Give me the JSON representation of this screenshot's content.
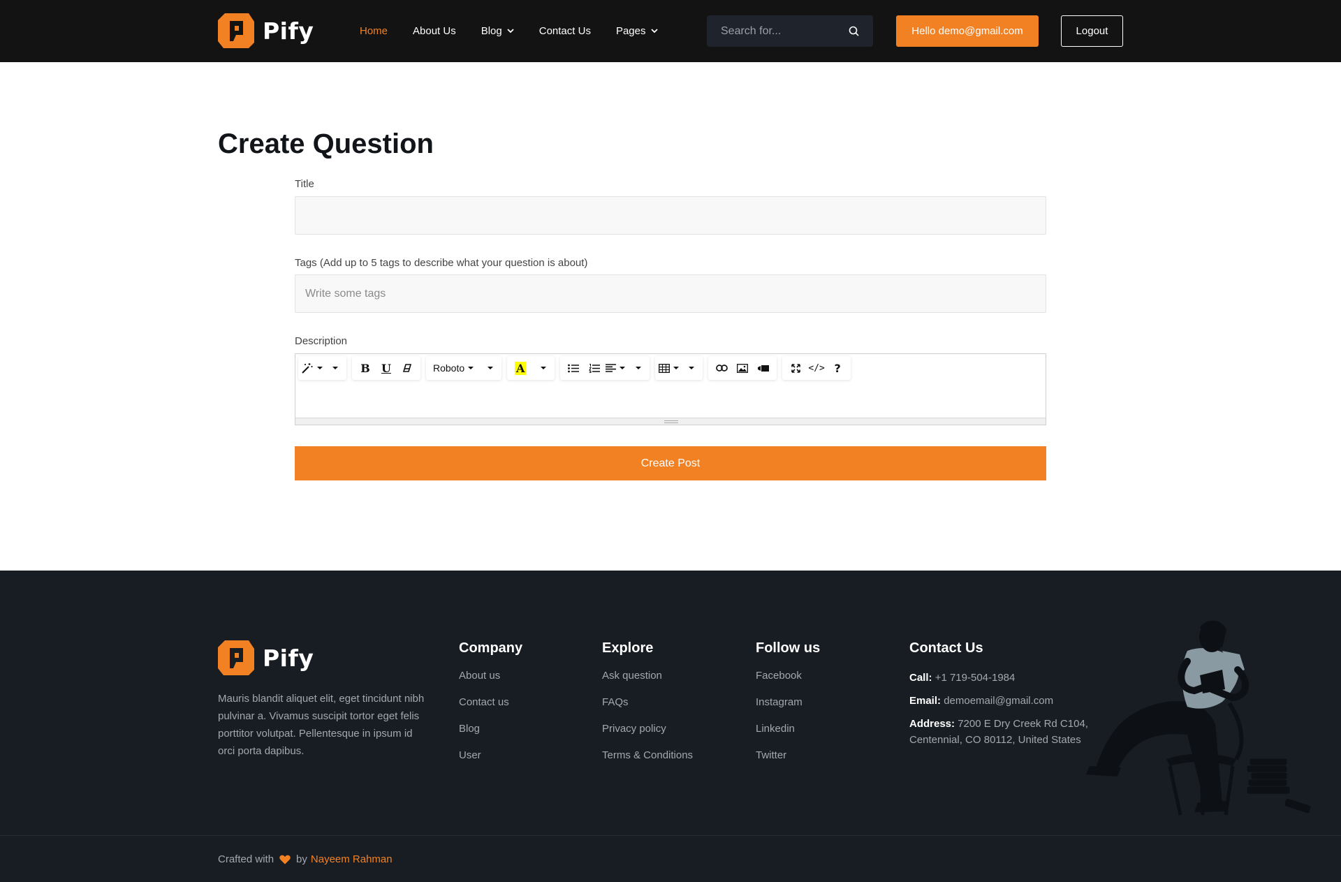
{
  "header": {
    "brand": "Pify",
    "nav": [
      {
        "label": "Home",
        "active": true
      },
      {
        "label": "About Us"
      },
      {
        "label": "Blog",
        "dropdown": true
      },
      {
        "label": "Contact Us"
      },
      {
        "label": "Pages",
        "dropdown": true
      }
    ],
    "search_placeholder": "Search for...",
    "hello_label": "Hello demo@gmail.com",
    "logout_label": "Logout"
  },
  "main": {
    "title": "Create Question",
    "title_label": "Title",
    "title_value": "",
    "tags_label": "Tags (Add up to 5 tags to describe what your question is about)",
    "tags_placeholder": "Write some tags",
    "description_label": "Description",
    "editor_font": "Roboto",
    "submit_label": "Create Post"
  },
  "footer": {
    "brand": "Pify",
    "about": "Mauris blandit aliquet elit, eget tincidunt nibh pulvinar a. Vivamus suscipit tortor eget felis porttitor volutpat. Pellentesque in ipsum id orci porta dapibus.",
    "company": {
      "title": "Company",
      "links": [
        "About us",
        "Contact us",
        "Blog",
        "User"
      ]
    },
    "explore": {
      "title": "Explore",
      "links": [
        "Ask question",
        "FAQs",
        "Privacy policy",
        "Terms & Conditions"
      ]
    },
    "follow": {
      "title": "Follow us",
      "links": [
        "Facebook",
        "Instagram",
        "Linkedin",
        "Twitter"
      ]
    },
    "contact": {
      "title": "Contact Us",
      "call_label": "Call:",
      "call_value": "+1 719-504-1984",
      "email_label": "Email:",
      "email_value": "demoemail@gmail.com",
      "address_label": "Address:",
      "address_value": "7200 E Dry Creek Rd C104, Centennial, CO 80112, United States"
    },
    "credit_prefix": "Crafted with",
    "credit_by": "by",
    "credit_author": "Nayeem Rahman"
  },
  "colors": {
    "accent": "#f28123",
    "header_bg": "#131313",
    "footer_bg": "#181d24"
  }
}
